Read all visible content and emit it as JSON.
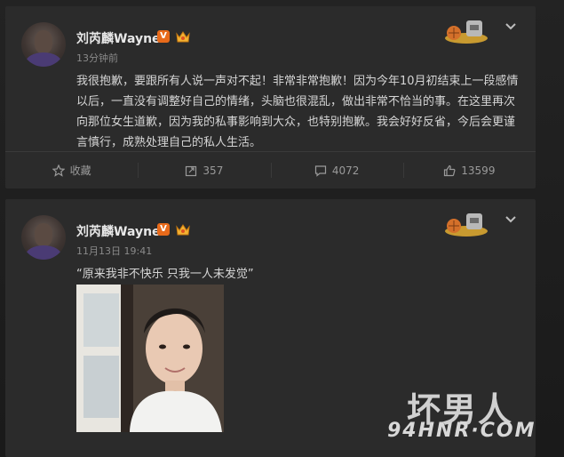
{
  "posts": [
    {
      "author": "刘芮麟Wayne",
      "verified_badge": "V",
      "time": "13分钟前",
      "text": "我很抱歉，要跟所有人说一声对不起！非常非常抱歉！因为今年10月初结束上一段感情以后，一直没有调整好自己的情绪，头脑也很混乱，做出非常不恰当的事。在这里再次向那位女生道歉，因为我的私事影响到大众，也特别抱歉。我会好好反省，今后会更谨言慎行，成熟处理自己的私人生活。",
      "actions": {
        "favorite": "收藏",
        "repost": "357",
        "comment": "4072",
        "like": "13599"
      }
    },
    {
      "author": "刘芮麟Wayne",
      "verified_badge": "V",
      "time": "11月13日 19:41",
      "text": "“原来我非不快乐 只我一人未发觉”"
    }
  ],
  "watermark": {
    "cn": "坏男人",
    "url": "94HNR·COM"
  },
  "icons": {
    "verified": "verified-v-icon",
    "member": "member-crown-icon",
    "decoration": "card-decoration-icon",
    "menu": "chevron-down-icon",
    "favorite": "star-icon",
    "repost": "repost-icon",
    "comment": "comment-icon",
    "like": "thumbs-up-icon"
  },
  "colors": {
    "background": "#1b1b1b",
    "card": "#2b2b2b",
    "accent": "#e86a1a"
  }
}
